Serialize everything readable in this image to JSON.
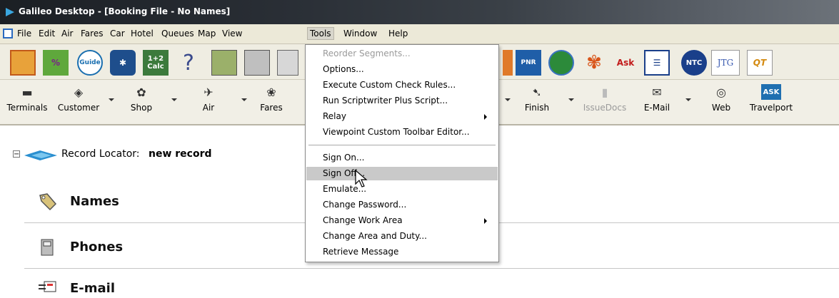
{
  "window": {
    "title": "Galileo Desktop - [Booking File - No Names]"
  },
  "menubar": {
    "items": [
      "File",
      "Edit",
      "Air",
      "Fares",
      "Car",
      "Hotel",
      "Queues",
      "Map",
      "View",
      "Tools",
      "Window",
      "Help"
    ],
    "active": "Tools"
  },
  "iconbar": {
    "icons": [
      "map-icon",
      "percent-icon",
      "guide-icon",
      "network-icon",
      "calc-icon",
      "help-icon",
      "print-ticket-icon",
      "print-icon",
      "document-icon",
      "pnr-icon",
      "globe-icon",
      "flower-icon",
      "ask-icon",
      "list-icon",
      "ntc-icon",
      "jtg-icon",
      "qt-icon"
    ],
    "labels": {
      "calc": "1+2 Calc",
      "guide": "Guide",
      "pnr": "PNR",
      "ask": "Ask",
      "ntc": "NTC",
      "jtg": "JTG",
      "qt": "QT",
      "help": "?"
    }
  },
  "toolbar": {
    "tools": [
      {
        "label": "Terminals",
        "icon": "computer-icon"
      },
      {
        "label": "Customer",
        "icon": "tag-icon"
      },
      {
        "label": "Shop",
        "icon": "shop-icon"
      },
      {
        "label": "Air",
        "icon": "plane-icon"
      },
      {
        "label": "Fares",
        "icon": "fares-icon"
      },
      {
        "label": "Finish",
        "icon": "finish-icon"
      },
      {
        "label": "IssueDocs",
        "icon": "issuedocs-icon",
        "disabled": true
      },
      {
        "label": "E-Mail",
        "icon": "email-icon"
      },
      {
        "label": "Web",
        "icon": "web-icon"
      },
      {
        "label": "Travelport",
        "icon": "ask-travelport-icon",
        "badge": "ASK"
      }
    ]
  },
  "record": {
    "label": "Record Locator:",
    "value": "new record"
  },
  "sections": [
    {
      "title": "Names",
      "icon": "tag-icon"
    },
    {
      "title": "Phones",
      "icon": "phone-icon"
    },
    {
      "title": "E-mail",
      "icon": "email-icon"
    }
  ],
  "tools_menu": {
    "items": [
      {
        "label": "Reorder Segments...",
        "disabled": true
      },
      {
        "label": "Options..."
      },
      {
        "label": "Execute Custom Check Rules..."
      },
      {
        "label": "Run Scriptwriter Plus Script..."
      },
      {
        "label": "Relay",
        "submenu": true
      },
      {
        "label": "Viewpoint Custom Toolbar Editor..."
      },
      {
        "label": "Sign On..."
      },
      {
        "label": "Sign Off...",
        "highlighted": true
      },
      {
        "label": "Emulate..."
      },
      {
        "label": "Change Password..."
      },
      {
        "label": "Change Work Area",
        "submenu": true
      },
      {
        "label": "Change Area and Duty..."
      },
      {
        "label": "Retrieve Message"
      }
    ]
  },
  "colors": {
    "title_bg": "#2a2f36",
    "menu_bg": "#ece9d8",
    "highlight": "#c9c9c9",
    "accent": "#2a6ac0"
  }
}
